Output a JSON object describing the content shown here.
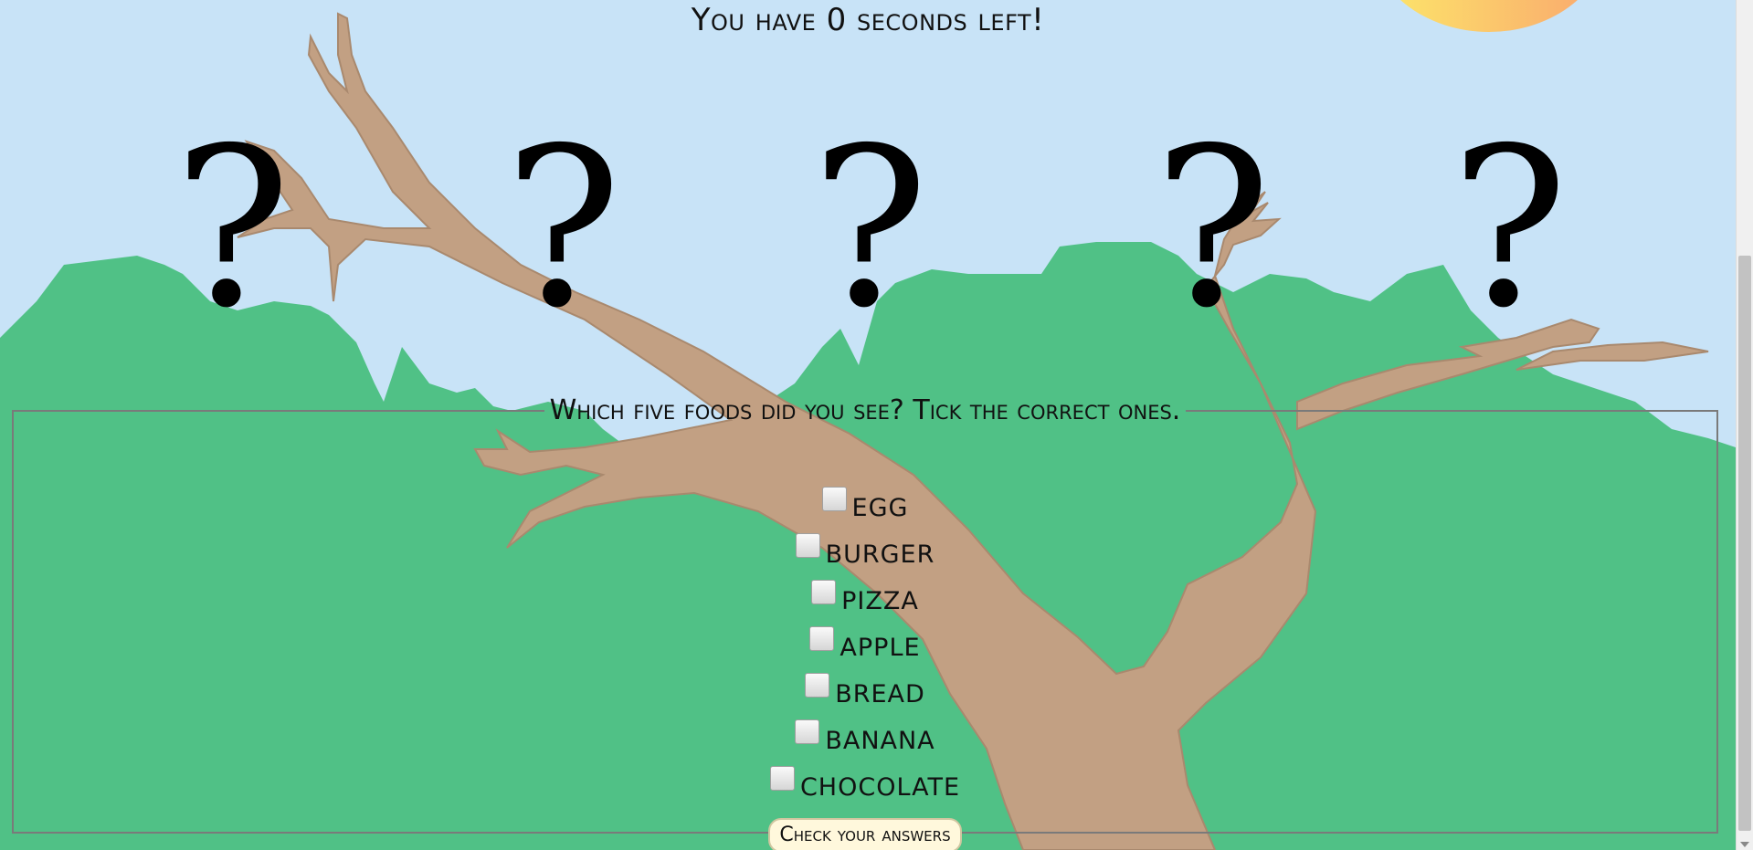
{
  "timer": {
    "text": "You have 0 seconds left!"
  },
  "mystery_marks": [
    "?",
    "?",
    "?",
    "?",
    "?"
  ],
  "quiz": {
    "legend": "Which five foods did you see? Tick the correct ones.",
    "options": [
      "EGG",
      "BURGER",
      "PIZZA",
      "APPLE",
      "BREAD",
      "BANANA",
      "CHOCOLATE"
    ],
    "submit_label": "Check your answers"
  },
  "colors": {
    "sky": "#c8e3f7",
    "foliage": "#50c186",
    "branch": "#c2a083",
    "sun": "#f9c05a"
  }
}
